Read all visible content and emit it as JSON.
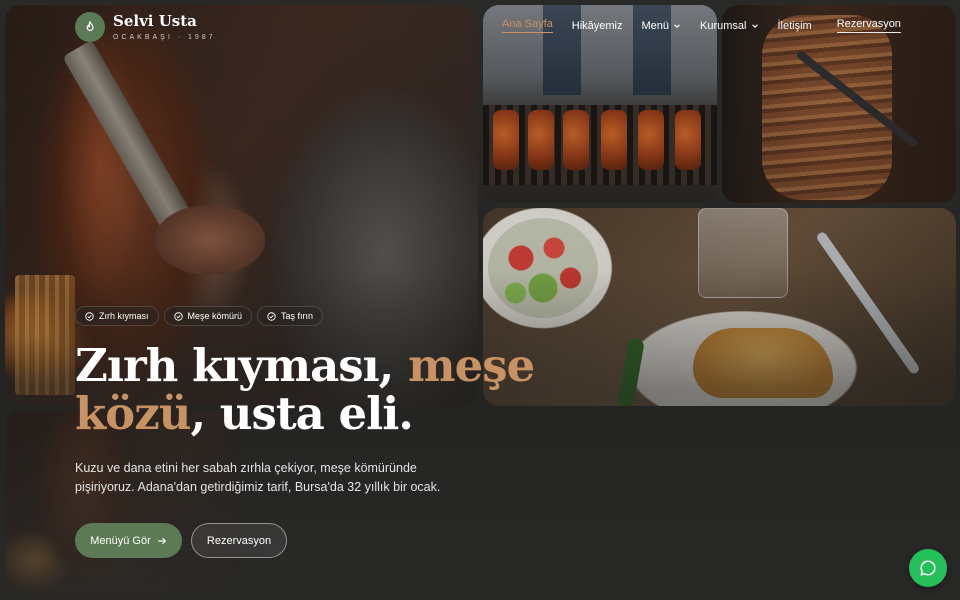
{
  "brand": {
    "name": "Selvi Usta",
    "tagline": "OCAKBAŞI · 1987",
    "logo_icon": "flame-icon",
    "accent_color": "#c99263",
    "primary_color": "#5b7a55"
  },
  "nav": {
    "items": [
      {
        "label": "Ana Sayfa",
        "active": true
      },
      {
        "label": "Hikâyemiz"
      },
      {
        "label": "Menü",
        "dropdown": true
      },
      {
        "label": "Kurumsal",
        "dropdown": true
      },
      {
        "label": "İletişim"
      }
    ],
    "cta_label": "Rezervasyon"
  },
  "hero": {
    "badges": [
      "Zırh kıyması",
      "Meşe kömürü",
      "Taş fırın"
    ],
    "title_part1": "Zırh kıyması, ",
    "title_accent1": "meşe",
    "title_accent2": "közü",
    "title_part2": ", usta eli.",
    "description": "Kuzu ve dana etini her sabah zırhla çekiyor, meşe kömüründe pişiriyoruz. Adana'dan getirdiğimiz tarif, Bursa'da 32 yıllık bir ocak.",
    "primary_button": "Menüyü Gör",
    "secondary_button": "Rezervasyon"
  },
  "chat": {
    "icon": "chat-bubble-icon",
    "color": "#25c05a"
  }
}
